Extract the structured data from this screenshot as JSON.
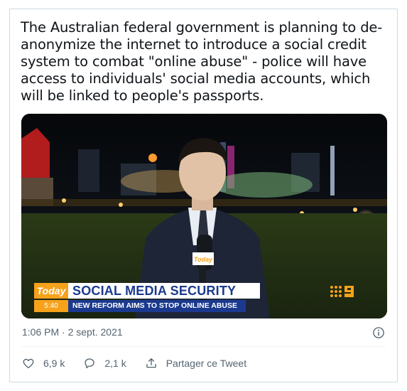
{
  "tweet": {
    "text": "The Australian federal government is planning to de-anonymize the internet to introduce a social credit system to combat \"online abuse\" - police will have access to individuals' social media accounts, which will be linked to people's passports.",
    "timestamp": "1:06 PM · 2 sept. 2021"
  },
  "media": {
    "logo": "Today",
    "time": "5:40",
    "headline": "SOCIAL MEDIA SECURITY",
    "subline": "NEW REFORM AIMS TO STOP ONLINE ABUSE",
    "mic_label": "Today",
    "channel_logo_icon": "nine-network-logo"
  },
  "actions": {
    "likes": "6,9 k",
    "replies": "2,1 k",
    "share_label": "Partager ce Tweet",
    "like_icon": "heart-icon",
    "reply_icon": "reply-icon",
    "share_icon": "share-icon",
    "info_icon": "info-icon"
  },
  "colors": {
    "text": "#0f1419",
    "muted": "#536471",
    "border": "#cfd9de",
    "today_orange": "#f6a21b",
    "banner_blue": "#1b3a8f"
  }
}
